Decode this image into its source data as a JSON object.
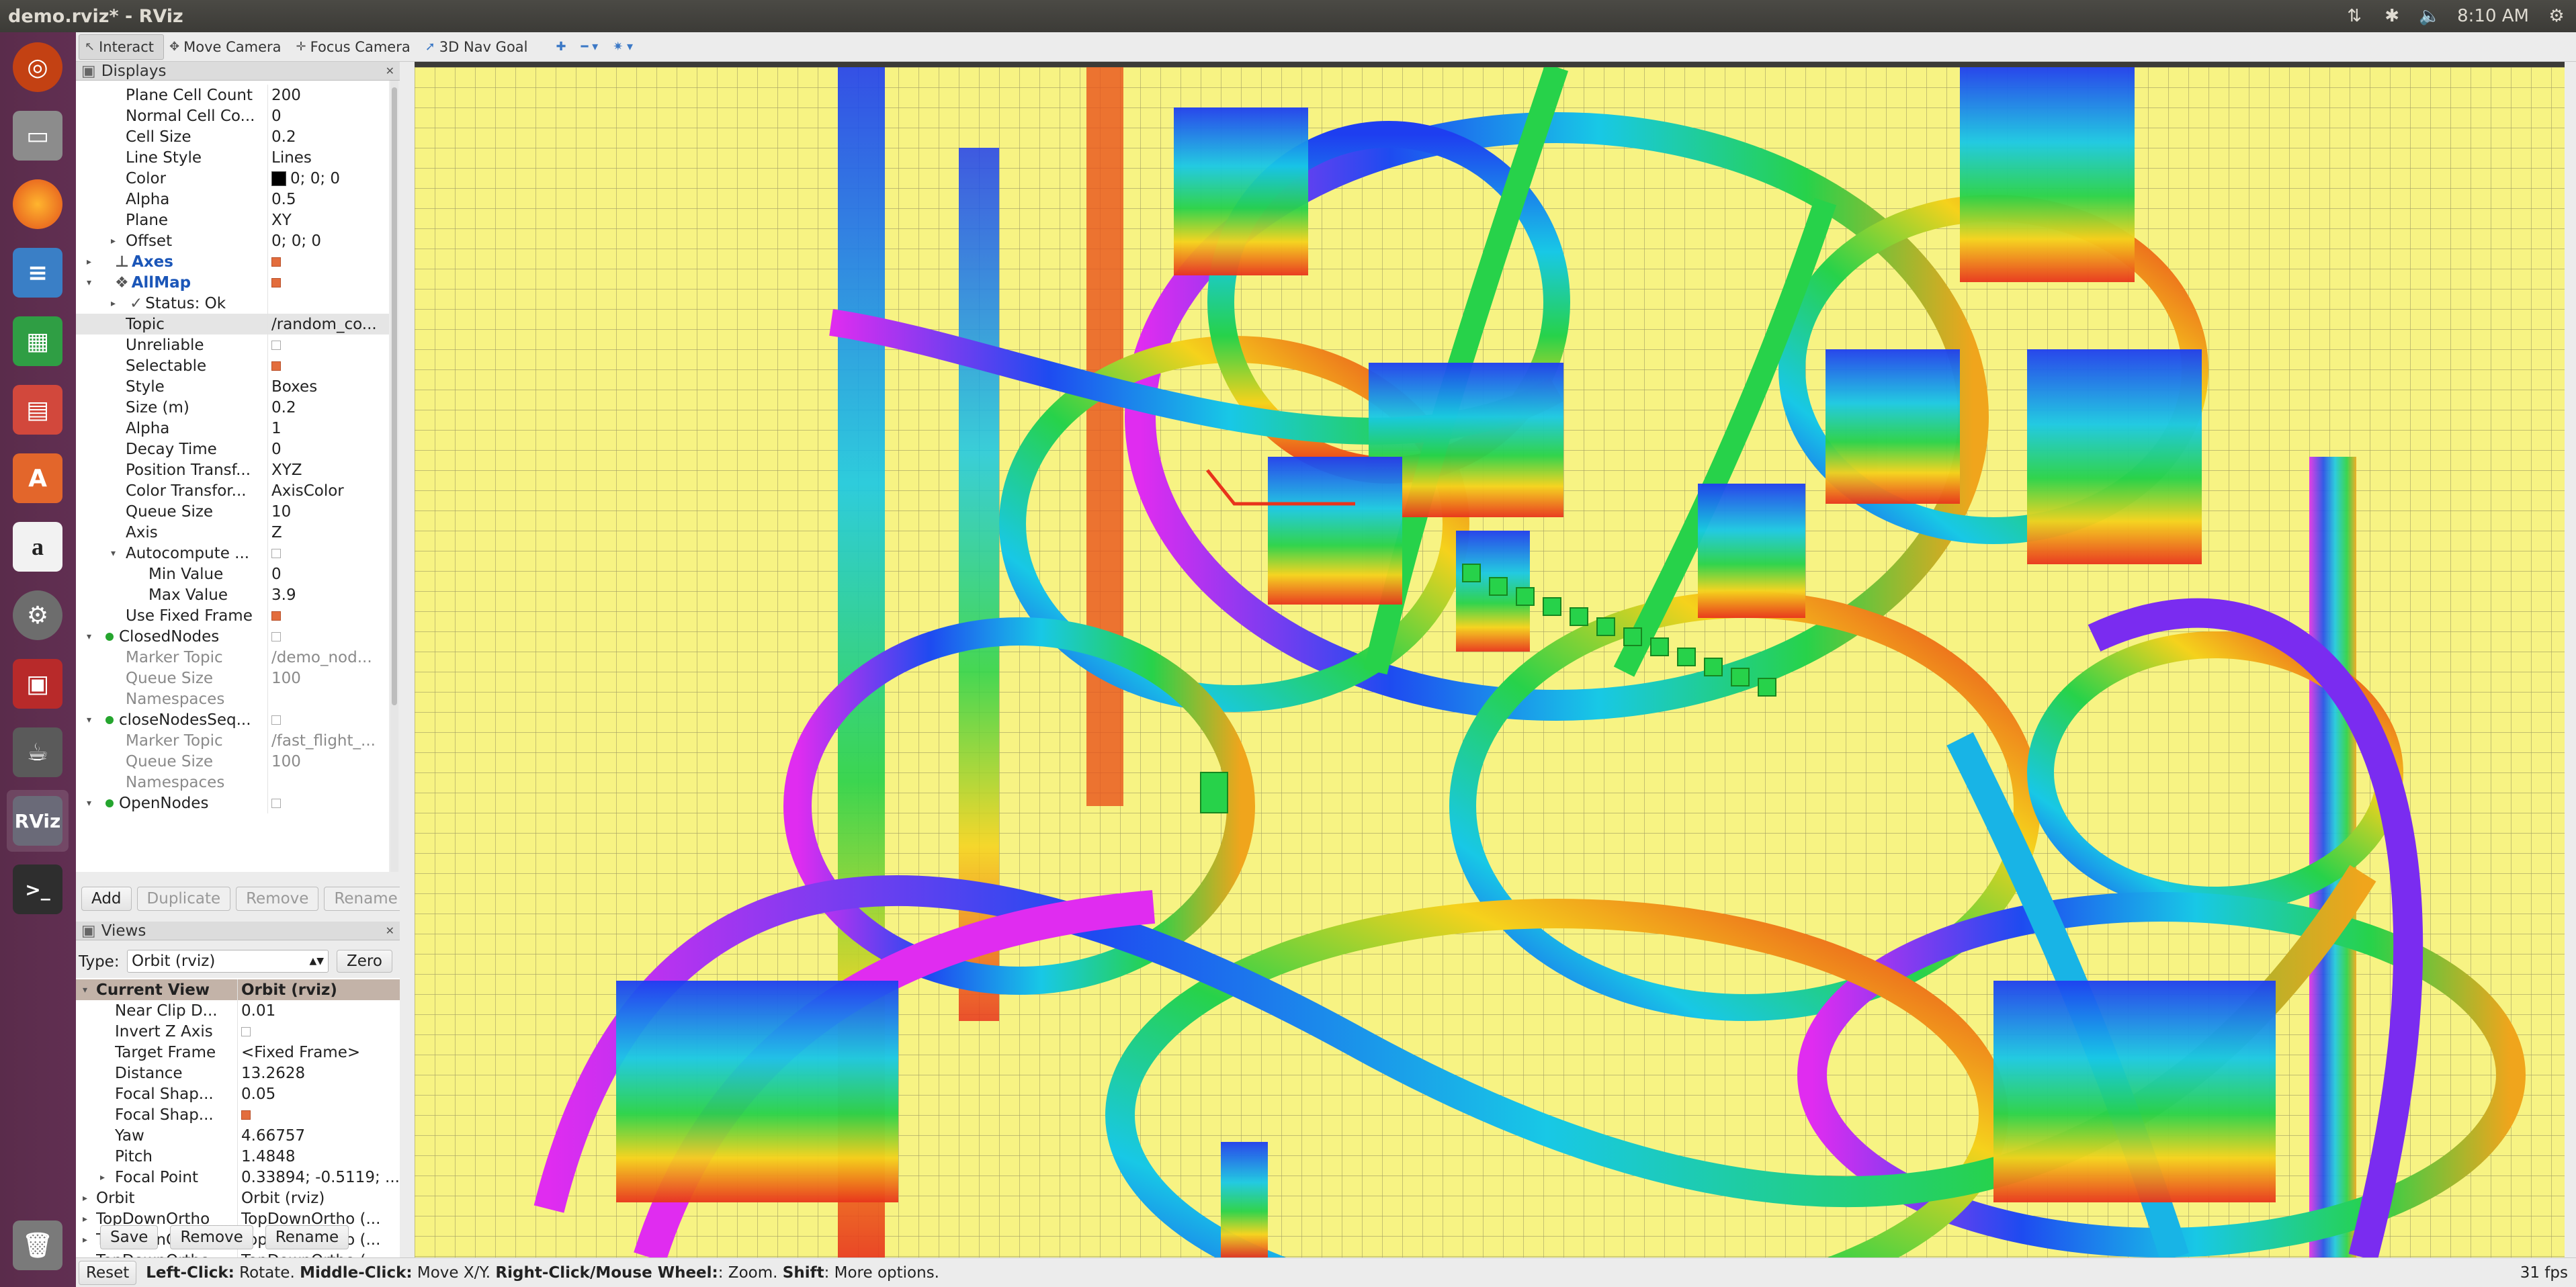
{
  "window": {
    "title": "demo.rviz* - RViz"
  },
  "topbar": {
    "time": "8:10 AM",
    "icons": [
      "network-icon",
      "bluetooth-icon",
      "volume-icon",
      "settings-icon"
    ]
  },
  "launcher": {
    "items": [
      {
        "name": "ubuntu-dash-icon",
        "color": "#dd4814"
      },
      {
        "name": "files-icon",
        "color": "#8c8c8c"
      },
      {
        "name": "firefox-icon",
        "color": "#ff7f1f"
      },
      {
        "name": "writer-icon",
        "color": "#3a7fc6"
      },
      {
        "name": "calc-icon",
        "color": "#2f9e44"
      },
      {
        "name": "impress-icon",
        "color": "#d2483c"
      },
      {
        "name": "software-center-icon",
        "color": "#e3662b"
      },
      {
        "name": "amazon-icon",
        "color": "#333333"
      },
      {
        "name": "system-settings-icon",
        "color": "#777777"
      },
      {
        "name": "red-app-icon",
        "color": "#b82a2a"
      },
      {
        "name": "java-icon",
        "color": "#6b6b6b"
      },
      {
        "name": "rviz-icon",
        "color": "#6a6a78"
      },
      {
        "name": "terminal-icon",
        "color": "#2e2e2e"
      },
      {
        "name": "trash-icon",
        "color": "#7a7a7a"
      }
    ],
    "rviz_label": "RViz"
  },
  "toolbar": {
    "interact": "Interact",
    "move_camera": "Move Camera",
    "focus_camera": "Focus Camera",
    "nav_goal": "3D Nav Goal"
  },
  "displays": {
    "title": "Displays",
    "rows": [
      {
        "k": "Plane Cell Count",
        "v": "200"
      },
      {
        "k": "Normal Cell Co...",
        "v": "0"
      },
      {
        "k": "Cell Size",
        "v": "0.2"
      },
      {
        "k": "Line Style",
        "v": "Lines"
      },
      {
        "k": "Color",
        "v": "0; 0; 0"
      },
      {
        "k": "Alpha",
        "v": "0.5"
      },
      {
        "k": "Plane",
        "v": "XY"
      },
      {
        "k": "Offset",
        "v": "0; 0; 0"
      },
      {
        "k": "Axes",
        "v": ""
      },
      {
        "k": "AllMap",
        "v": ""
      },
      {
        "k": "Status: Ok",
        "v": ""
      },
      {
        "k": "Topic",
        "v": "/random_co..."
      },
      {
        "k": "Unreliable",
        "v": ""
      },
      {
        "k": "Selectable",
        "v": ""
      },
      {
        "k": "Style",
        "v": "Boxes"
      },
      {
        "k": "Size (m)",
        "v": "0.2"
      },
      {
        "k": "Alpha",
        "v": "1"
      },
      {
        "k": "Decay Time",
        "v": "0"
      },
      {
        "k": "Position Transf...",
        "v": "XYZ"
      },
      {
        "k": "Color Transfor...",
        "v": "AxisColor"
      },
      {
        "k": "Queue Size",
        "v": "10"
      },
      {
        "k": "Axis",
        "v": "Z"
      },
      {
        "k": "Autocompute ...",
        "v": ""
      },
      {
        "k": "Min Value",
        "v": "0"
      },
      {
        "k": "Max Value",
        "v": "3.9"
      },
      {
        "k": "Use Fixed Frame",
        "v": ""
      },
      {
        "k": "ClosedNodes",
        "v": ""
      },
      {
        "k": "Marker Topic",
        "v": "/demo_nod..."
      },
      {
        "k": "Queue Size",
        "v": "100"
      },
      {
        "k": "Namespaces",
        "v": ""
      },
      {
        "k": "closeNodesSeq...",
        "v": ""
      },
      {
        "k": "Marker Topic",
        "v": "/fast_flight_..."
      },
      {
        "k": "Queue Size",
        "v": "100"
      },
      {
        "k": "Namespaces",
        "v": ""
      },
      {
        "k": "OpenNodes",
        "v": ""
      }
    ],
    "buttons": {
      "add": "Add",
      "duplicate": "Duplicate",
      "remove": "Remove",
      "rename": "Rename"
    }
  },
  "views": {
    "title": "Views",
    "type_label": "Type:",
    "type_value": "Orbit (rviz)",
    "zero": "Zero",
    "rows": [
      {
        "k": "Current View",
        "v": "Orbit (rviz)"
      },
      {
        "k": "Near Clip D...",
        "v": "0.01"
      },
      {
        "k": "Invert Z Axis",
        "v": ""
      },
      {
        "k": "Target Frame",
        "v": "<Fixed Frame>"
      },
      {
        "k": "Distance",
        "v": "13.2628"
      },
      {
        "k": "Focal Shap...",
        "v": "0.05"
      },
      {
        "k": "Focal Shap...",
        "v": ""
      },
      {
        "k": "Yaw",
        "v": "4.66757"
      },
      {
        "k": "Pitch",
        "v": "1.4848"
      },
      {
        "k": "Focal Point",
        "v": "0.33894; -0.5119; ..."
      },
      {
        "k": "Orbit",
        "v": "Orbit (rviz)"
      },
      {
        "k": "TopDownOrtho",
        "v": "TopDownOrtho (..."
      },
      {
        "k": "TopDownOrtho",
        "v": "TopDownOrtho (..."
      },
      {
        "k": "TopDownOrtho",
        "v": "TopDownOrtho (..."
      }
    ],
    "buttons": {
      "save": "Save",
      "remove": "Remove",
      "rename": "Rename"
    }
  },
  "status": {
    "reset": "Reset",
    "left_click": "Left-Click:",
    "left_click_action": " Rotate. ",
    "middle_click": "Middle-Click:",
    "middle_click_action": " Move X/Y. ",
    "right_click": "Right-Click/Mouse Wheel:",
    "right_click_action": ": Zoom. ",
    "shift": "Shift",
    "shift_action": ": More options.",
    "fps": "31 fps"
  },
  "colors": {
    "grid_bg": "#f7f383",
    "grid_line": "#7d7a55"
  }
}
